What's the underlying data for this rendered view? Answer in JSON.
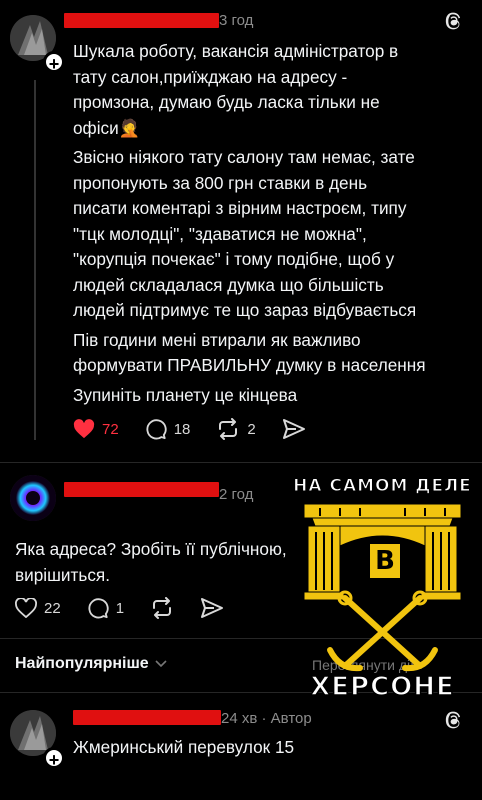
{
  "post1": {
    "time": "3 год",
    "text": [
      "Шукала роботу, вакансія адміністратор в",
      "тату салон,приїжджаю на адресу -",
      "промзона, думаю будь ласка тільки не",
      "офіси🤦",
      "Звісно ніякого тату салону там немає, зате",
      "пропонують за 800 грн ставки в день",
      "писати коментарі з вірним настроєм, типу",
      "\"тцк молодці\", \"здаватися не можна\",",
      "\"корупція почекає\" і тому подібне, щоб у",
      "людей складалася думка що більшість",
      "людей підтримує те що зараз відбувається",
      "Пів години мені втирали як важливо",
      "формувати ПРАВИЛЬНУ думку в населення",
      "Зупиніть планету це кінцева"
    ],
    "likes": "72",
    "comments": "18",
    "reposts": "2",
    "like_color": "#ff3040"
  },
  "post2": {
    "time": "2 год",
    "text": [
      "Яка адреса? Зробіть її публічною,",
      "вирішиться."
    ],
    "likes": "22",
    "comments": "1"
  },
  "sort": {
    "label": "Найпопулярніше",
    "right": "Переглянути дії"
  },
  "post3": {
    "time": "24 хв",
    "sep": " · ",
    "author_tag": "Автор",
    "text": "Жмеринський перевулок 15"
  },
  "watermark": {
    "top": "НА САМОМ ДЕЛЕ",
    "middle": "В",
    "bottom": "ХЕРСОНЕ",
    "color": "#f1c40f"
  }
}
